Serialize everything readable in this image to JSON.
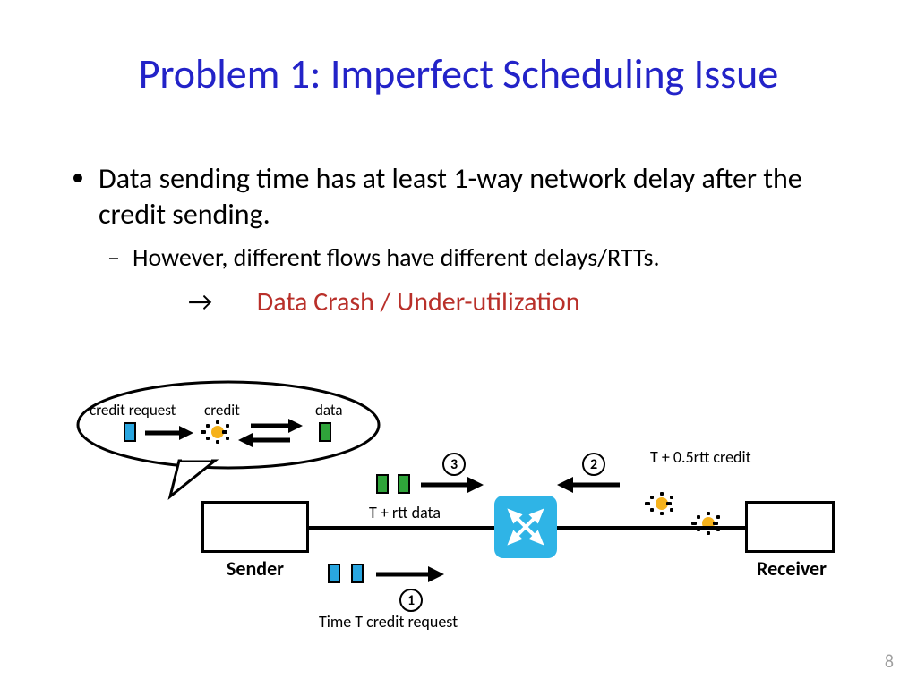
{
  "title": "Problem 1: Imperfect Scheduling Issue",
  "bullet1": "Data sending time has at least 1-way network delay after the credit sending.",
  "sub1": "However, different flows have different delays/RTTs.",
  "consequence_arrow": "→",
  "consequence_text": "Data Crash / Under-utilization",
  "legend": {
    "credit_request": "credit request",
    "credit": "credit",
    "data": "data"
  },
  "labels": {
    "sender": "Sender",
    "receiver": "Receiver",
    "t_rtt_data": "T + rtt data",
    "t_half_rtt_credit": "T + 0.5rtt credit",
    "time_t_credit_req": "Time T credit request",
    "step1": "1",
    "step2": "2",
    "step3": "3"
  },
  "page_number": "8"
}
